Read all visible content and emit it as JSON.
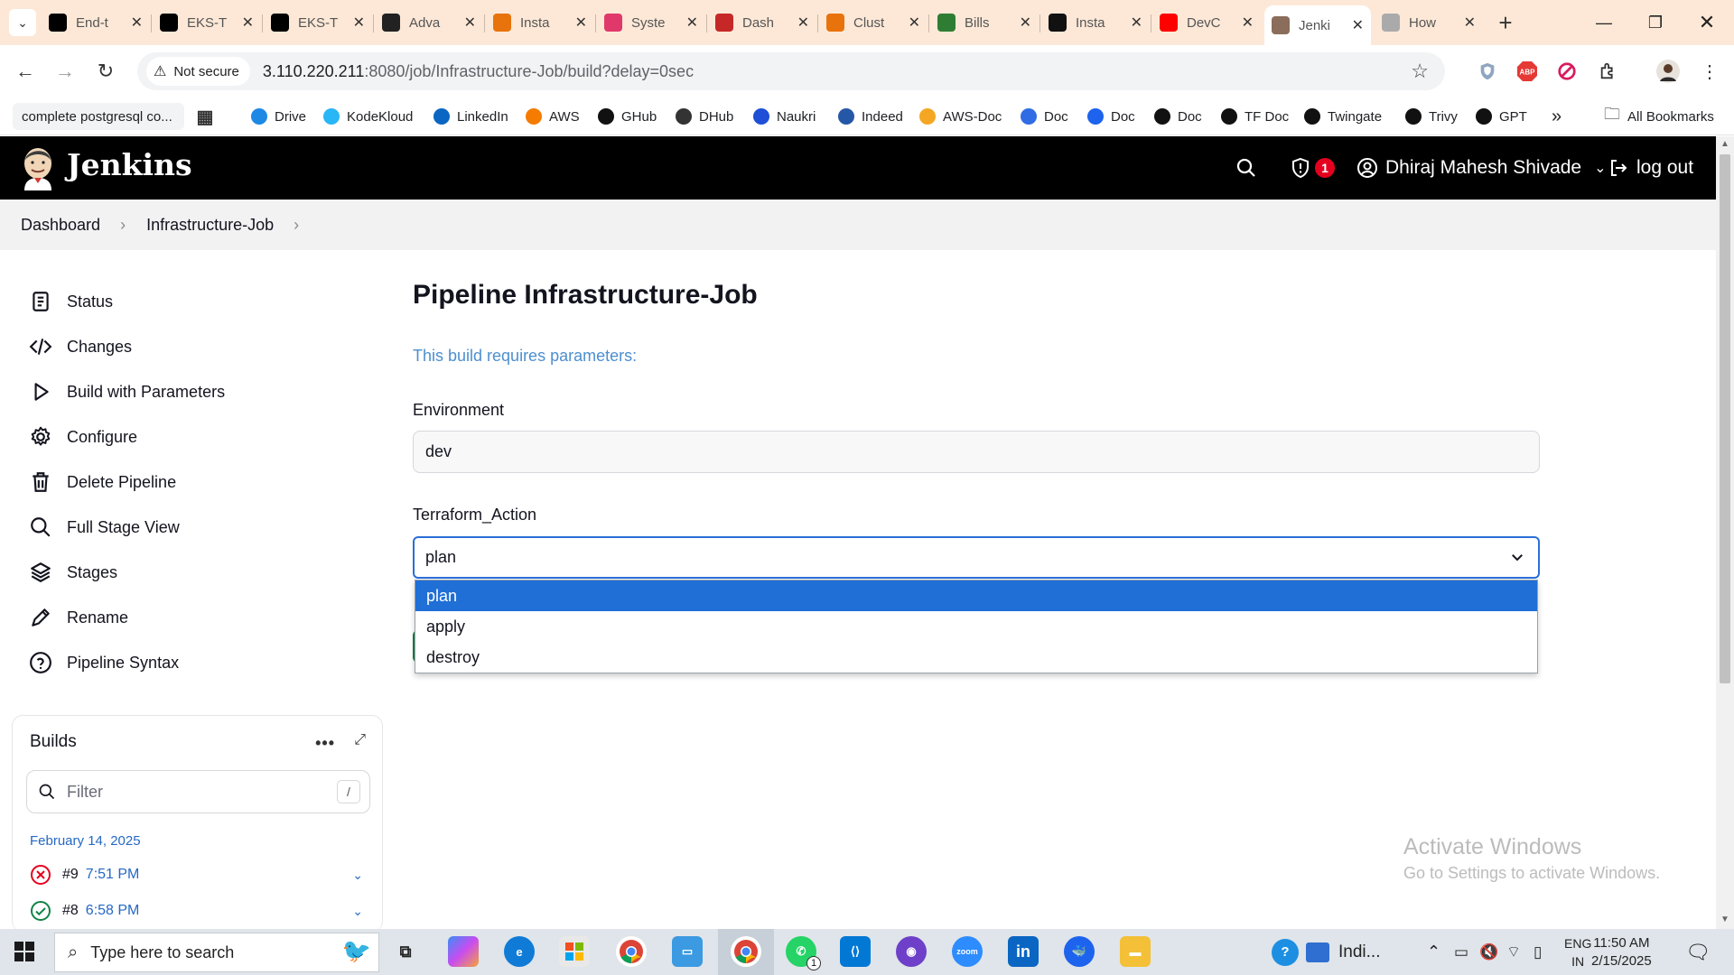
{
  "browser": {
    "tabs": [
      {
        "title": "End-t",
        "icon": "github-icon",
        "color": "#000000"
      },
      {
        "title": "EKS-T",
        "icon": "github-icon",
        "color": "#000000"
      },
      {
        "title": "EKS-T",
        "icon": "github-icon",
        "color": "#000000"
      },
      {
        "title": "Adva",
        "icon": "graduation-cap-icon",
        "color": "#222222"
      },
      {
        "title": "Insta",
        "icon": "aws-icon",
        "color": "#e8730c"
      },
      {
        "title": "Syste",
        "icon": "aws-icon",
        "color": "#e0386a"
      },
      {
        "title": "Dash",
        "icon": "dashboard-icon",
        "color": "#c62828"
      },
      {
        "title": "Clust",
        "icon": "aws-icon",
        "color": "#e8730c"
      },
      {
        "title": "Bills",
        "icon": "bills-icon",
        "color": "#2e7d32"
      },
      {
        "title": "Insta",
        "icon": "openai-icon",
        "color": "#111111"
      },
      {
        "title": "DevC",
        "icon": "youtube-icon",
        "color": "#ff0000"
      },
      {
        "title": "Jenki",
        "icon": "jenkins-icon",
        "color": "#8a6d5b",
        "active": true
      },
      {
        "title": "How",
        "icon": "loading-icon",
        "color": "#aaaaaa"
      }
    ],
    "address": {
      "security_label": "Not secure",
      "host": "3.110.220.211",
      "path": ":8080/job/Infrastructure-Job/build?delay=0sec"
    },
    "bookmarks": [
      {
        "label": "complete postgresql co...",
        "icon": "",
        "color": ""
      },
      {
        "label": "",
        "icon": "apps-grid-icon",
        "color": "#333333"
      },
      {
        "label": "Drive",
        "icon": "drive-icon",
        "color": "#1e88e5"
      },
      {
        "label": "KodeKloud",
        "icon": "kodekloud-icon",
        "color": "#29b6f6"
      },
      {
        "label": "LinkedIn",
        "icon": "linkedin-icon",
        "color": "#0a66c2"
      },
      {
        "label": "AWS",
        "icon": "aws-icon",
        "color": "#f57c00"
      },
      {
        "label": "GHub",
        "icon": "github-icon",
        "color": "#111111"
      },
      {
        "label": "DHub",
        "icon": "dockerhub-icon",
        "color": "#333333"
      },
      {
        "label": "Naukri",
        "icon": "naukri-icon",
        "color": "#1e4fd6"
      },
      {
        "label": "Indeed",
        "icon": "indeed-icon",
        "color": "#2557a7"
      },
      {
        "label": "AWS-Doc",
        "icon": "aws-doc-icon",
        "color": "#f5a623"
      },
      {
        "label": "Doc",
        "icon": "k8s-icon",
        "color": "#326ce5"
      },
      {
        "label": "Doc",
        "icon": "docker-icon",
        "color": "#1d63ed"
      },
      {
        "label": "Doc",
        "icon": "ansible-icon",
        "color": "#111111"
      },
      {
        "label": "TF Doc",
        "icon": "terraform-icon",
        "color": "#111111"
      },
      {
        "label": "Twingate",
        "icon": "twingate-icon",
        "color": "#111111"
      },
      {
        "label": "Trivy",
        "icon": "trivy-icon",
        "color": "#111111"
      },
      {
        "label": "GPT",
        "icon": "openai-icon",
        "color": "#111111"
      }
    ],
    "all_bookmarks": "All Bookmarks"
  },
  "jenkins": {
    "name": "Jenkins",
    "security_count": "1",
    "user": "Dhiraj Mahesh Shivade",
    "logout": "log out",
    "breadcrumb": [
      "Dashboard",
      "Infrastructure-Job"
    ],
    "sidebar": [
      {
        "label": "Status",
        "icon": "status-icon"
      },
      {
        "label": "Changes",
        "icon": "code-icon"
      },
      {
        "label": "Build with Parameters",
        "icon": "play-icon"
      },
      {
        "label": "Configure",
        "icon": "gear-icon"
      },
      {
        "label": "Delete Pipeline",
        "icon": "trash-icon"
      },
      {
        "label": "Full Stage View",
        "icon": "search-icon"
      },
      {
        "label": "Stages",
        "icon": "layers-icon"
      },
      {
        "label": "Rename",
        "icon": "pencil-icon"
      },
      {
        "label": "Pipeline Syntax",
        "icon": "help-icon"
      }
    ],
    "builds": {
      "title": "Builds",
      "filter_placeholder": "Filter",
      "filter_shortcut": "/",
      "date": "February 14, 2025",
      "rows": [
        {
          "number": "#9",
          "time": "7:51 PM",
          "status": "failed"
        },
        {
          "number": "#8",
          "time": "6:58 PM",
          "status": "success"
        }
      ]
    },
    "main": {
      "title": "Pipeline Infrastructure-Job",
      "description": "This build requires parameters:",
      "param_environment_label": "Environment",
      "param_environment_value": "dev",
      "param_action_label": "Terraform_Action",
      "param_action_value": "plan",
      "options": [
        "plan",
        "apply",
        "destroy"
      ],
      "selected_option": "plan"
    }
  },
  "watermark": {
    "line1": "Activate Windows",
    "line2": "Go to Settings to activate Windows."
  },
  "taskbar": {
    "search_placeholder": "Type here to search",
    "weather": "Indi...",
    "lang_top": "ENG",
    "lang_bottom": "IN",
    "time": "11:50 AM",
    "date": "2/15/2025",
    "whatsapp_count": "1"
  },
  "colors": {
    "jenkins_header": "#000000",
    "selection_blue": "#1f6fd6",
    "link_blue": "#2568c4",
    "failure_red": "#e6001f",
    "success_green": "#138347"
  }
}
